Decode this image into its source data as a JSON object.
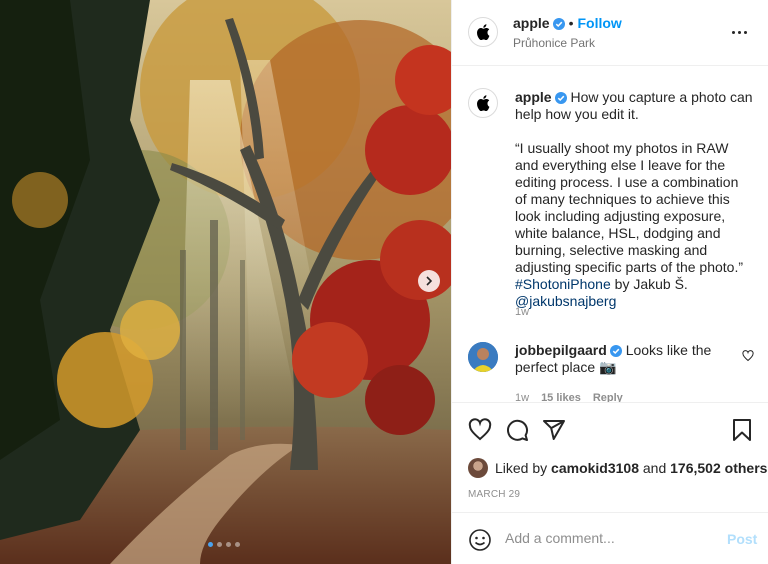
{
  "post": {
    "author": "apple",
    "follow_label": "Follow",
    "separator": "•",
    "location": "Průhonice Park",
    "icons": {
      "verified": "verified-badge-icon",
      "more": "more-options-icon",
      "next": "chevron-right-icon"
    }
  },
  "caption": {
    "author": "apple",
    "line1": "How you capture a photo can help how you edit it.",
    "quote": "“I usually shoot my photos in RAW and everything else I leave for the editing process. I use a combination of many techniques to achieve this look including adjusting exposure, white balance, HSL, dodging and burning, selective masking and adjusting specific parts of the photo.”",
    "hashtag": "#ShotoniPhone",
    "by_text": "by Jakub Š.",
    "mention": "@jakubsnajberg",
    "age": "1w"
  },
  "comment": {
    "author": "jobbepilgaard",
    "text": "Looks like the perfect place",
    "emoji": "📷",
    "age": "1w",
    "likes": "15 likes",
    "reply_label": "Reply"
  },
  "likes": {
    "prefix": "Liked by",
    "user": "camokid3108",
    "middle": "and",
    "others": "176,502 others"
  },
  "date": "MARCH 29",
  "add_comment": {
    "placeholder": "Add a comment...",
    "post_label": "Post"
  },
  "carousel": {
    "count": 4,
    "active": 1
  },
  "colors": {
    "accent": "#0095f6",
    "verified": "#3897f0",
    "post_disabled": "#b2dffc",
    "carousel_active": "#4aa3ef"
  }
}
